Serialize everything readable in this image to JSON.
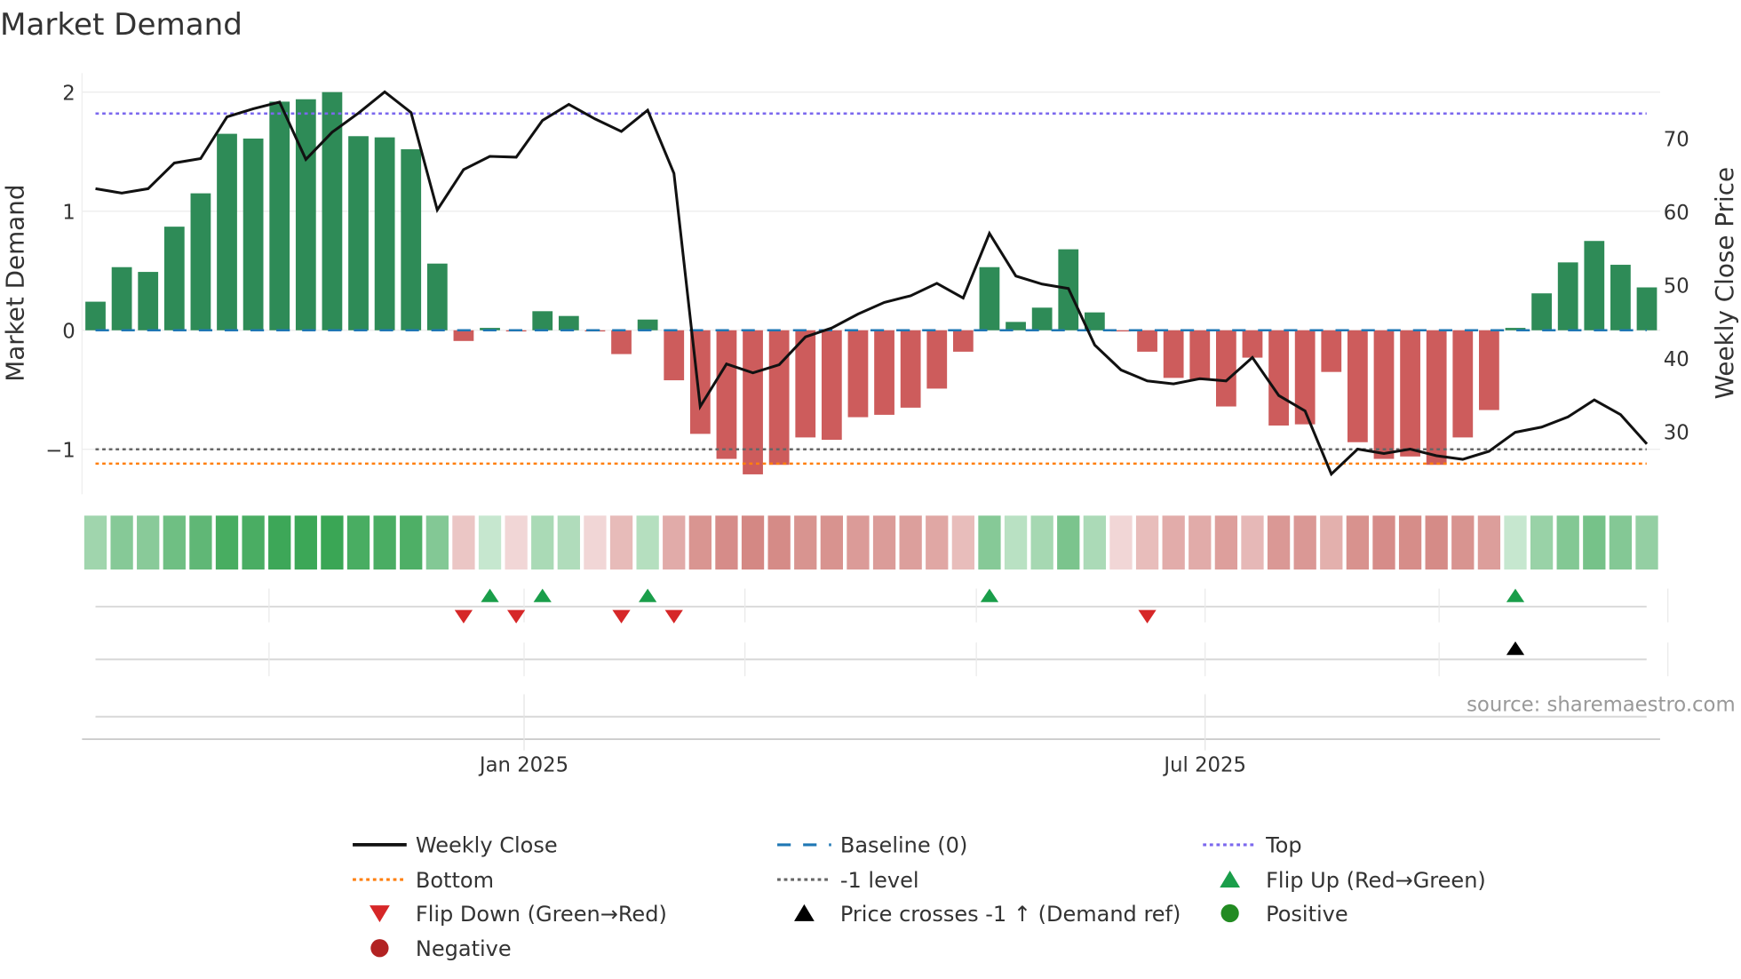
{
  "chart_data": {
    "type": "bar",
    "title": "Market Demand",
    "ylabel": "Market Demand",
    "y2label": "Weekly Close Price",
    "ylim": [
      -1.38,
      2.16
    ],
    "y2lim": [
      21.4,
      79.0
    ],
    "yticks": [
      {
        "v": 2,
        "label": "2"
      },
      {
        "v": 1,
        "label": "1"
      },
      {
        "v": 0,
        "label": "0"
      },
      {
        "v": -1,
        "label": "−1"
      }
    ],
    "y2ticks": [
      {
        "v": 70,
        "label": "70"
      },
      {
        "v": 60,
        "label": "60"
      },
      {
        "v": 50,
        "label": "50"
      },
      {
        "v": 40,
        "label": "40"
      },
      {
        "v": 30,
        "label": "30"
      }
    ],
    "xticks": [
      {
        "index": 16.3,
        "label": "Jan 2025"
      },
      {
        "index": 42.2,
        "label": "Jul 2025"
      }
    ],
    "minor_grid_index": [
      6.6,
      16.3,
      24.7,
      33.5,
      42.2,
      51.1,
      59.8
    ],
    "source": "source: sharemaestro.com",
    "demand": [
      0.24,
      0.53,
      0.49,
      0.87,
      1.15,
      1.65,
      1.61,
      1.92,
      1.94,
      2.0,
      1.63,
      1.62,
      1.52,
      0.56,
      -0.09,
      0.02,
      -0.01,
      0.16,
      0.12,
      -0.01,
      -0.2,
      0.09,
      -0.42,
      -0.87,
      -1.08,
      -1.21,
      -1.13,
      -0.9,
      -0.92,
      -0.73,
      -0.71,
      -0.65,
      -0.49,
      -0.18,
      0.53,
      0.07,
      0.19,
      0.68,
      0.15,
      -0.01,
      -0.18,
      -0.4,
      -0.42,
      -0.64,
      -0.23,
      -0.8,
      -0.79,
      -0.35,
      -0.94,
      -1.08,
      -1.06,
      -1.13,
      -0.9,
      -0.67,
      0.02,
      0.31,
      0.57,
      0.75,
      0.55,
      0.36
    ],
    "weekly_close": [
      63.1,
      62.5,
      63.1,
      66.6,
      67.2,
      72.9,
      74.0,
      74.9,
      67.1,
      70.8,
      73.4,
      76.3,
      73.5,
      60.2,
      65.7,
      67.5,
      67.4,
      72.4,
      74.6,
      72.6,
      70.9,
      73.8,
      65.2,
      33.4,
      39.2,
      38.0,
      39.1,
      42.9,
      44.1,
      46.0,
      47.6,
      48.5,
      50.2,
      48.2,
      57.0,
      51.2,
      50.1,
      49.5,
      41.8,
      38.4,
      36.9,
      36.5,
      37.2,
      36.9,
      40.1,
      34.9,
      32.8,
      24.2,
      27.6,
      27.0,
      27.6,
      26.7,
      26.2,
      27.3,
      29.9,
      30.6,
      32.0,
      34.3,
      32.3,
      28.3
    ],
    "reference_lines": {
      "baseline": 0,
      "top": 1.82,
      "minus_one": -1,
      "bottom": -1.12
    },
    "flip_up_index": [
      15,
      17,
      21,
      34,
      54
    ],
    "flip_down_index": [
      14,
      16,
      20,
      22,
      40
    ],
    "price_cross_index": [
      54
    ],
    "colors": {
      "positive": "#2e8b57",
      "negative": "#cd5c5c",
      "line": "#111111",
      "baseline": "#1f77b4",
      "top": "#7b68ee",
      "bottom": "#ff7f0e",
      "minus_one": "#666666",
      "flip_up": "#1a9e4a",
      "flip_down": "#d62728",
      "cross": "#000000",
      "pos_dot": "#228b22",
      "neg_dot": "#b22222"
    },
    "legend": [
      {
        "label": "Weekly Close",
        "sym": "line"
      },
      {
        "label": "Baseline (0)",
        "sym": "dash"
      },
      {
        "label": "Top",
        "sym": "dot-top"
      },
      {
        "label": "Bottom",
        "sym": "dot-bottom"
      },
      {
        "label": "-1 level",
        "sym": "dot-minus"
      },
      {
        "label": "Flip Up (Red→Green)",
        "sym": "tri-up"
      },
      {
        "label": "Flip Down (Green→Red)",
        "sym": "tri-down"
      },
      {
        "label": "Price crosses -1 ↑ (Demand ref)",
        "sym": "tri-cross"
      },
      {
        "label": "Positive",
        "sym": "dot-pos"
      },
      {
        "label": "Negative",
        "sym": "dot-neg"
      }
    ]
  }
}
